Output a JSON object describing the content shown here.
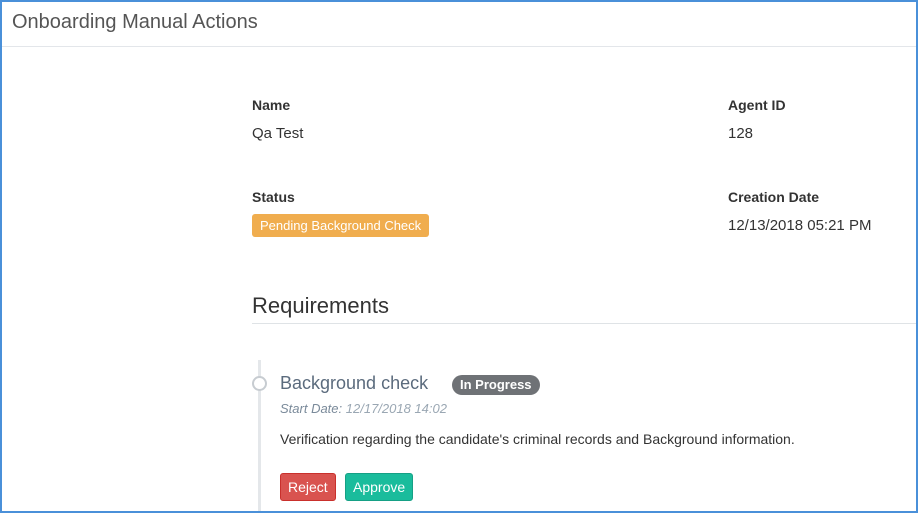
{
  "header": {
    "title": "Onboarding Manual Actions"
  },
  "details": {
    "name_label": "Name",
    "name_value": "Qa Test",
    "agent_id_label": "Agent ID",
    "agent_id_value": "128",
    "status_label": "Status",
    "status_value": "Pending Background Check",
    "creation_date_label": "Creation Date",
    "creation_date_value": "12/13/2018 05:21 PM"
  },
  "requirements": {
    "title": "Requirements",
    "items": [
      {
        "title": "Background check",
        "status": "In Progress",
        "start_date_label": "Start Date:",
        "start_date_value": "12/17/2018 14:02",
        "description": "Verification regarding the candidate's criminal records and Background information.",
        "reject_label": "Reject",
        "approve_label": "Approve"
      }
    ]
  },
  "colors": {
    "frame_border": "#4a90d9",
    "status_warning": "#f0ad4e",
    "in_progress": "#6f7276",
    "reject": "#d9534f",
    "approve": "#1abc9c"
  }
}
